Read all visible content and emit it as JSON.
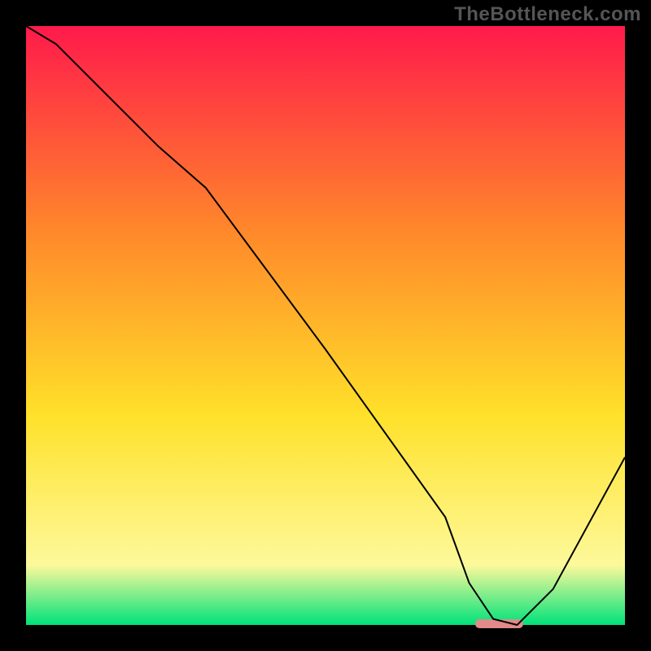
{
  "watermark": "TheBottleneck.com",
  "chart_data": {
    "type": "line",
    "title": "",
    "xlabel": "",
    "ylabel": "",
    "xlim": [
      0,
      100
    ],
    "ylim": [
      0,
      100
    ],
    "background_gradient": {
      "top": "#ff1a4b",
      "mid_upper": "#ff8a2a",
      "mid": "#ffe12a",
      "mid_lower": "#fdf99b",
      "bottom": "#00e27a"
    },
    "series": [
      {
        "name": "bottleneck-curve",
        "color": "#000000",
        "stroke_width": 2,
        "x": [
          0,
          5,
          22,
          30,
          50,
          70,
          74,
          78,
          82,
          88,
          100
        ],
        "values": [
          100,
          97,
          80,
          73,
          46,
          18,
          7,
          1,
          0,
          6,
          28
        ]
      }
    ],
    "optimal_marker": {
      "name": "optimal-range",
      "color": "#e08a8a",
      "x_start": 75,
      "x_end": 83,
      "y": 0
    }
  }
}
